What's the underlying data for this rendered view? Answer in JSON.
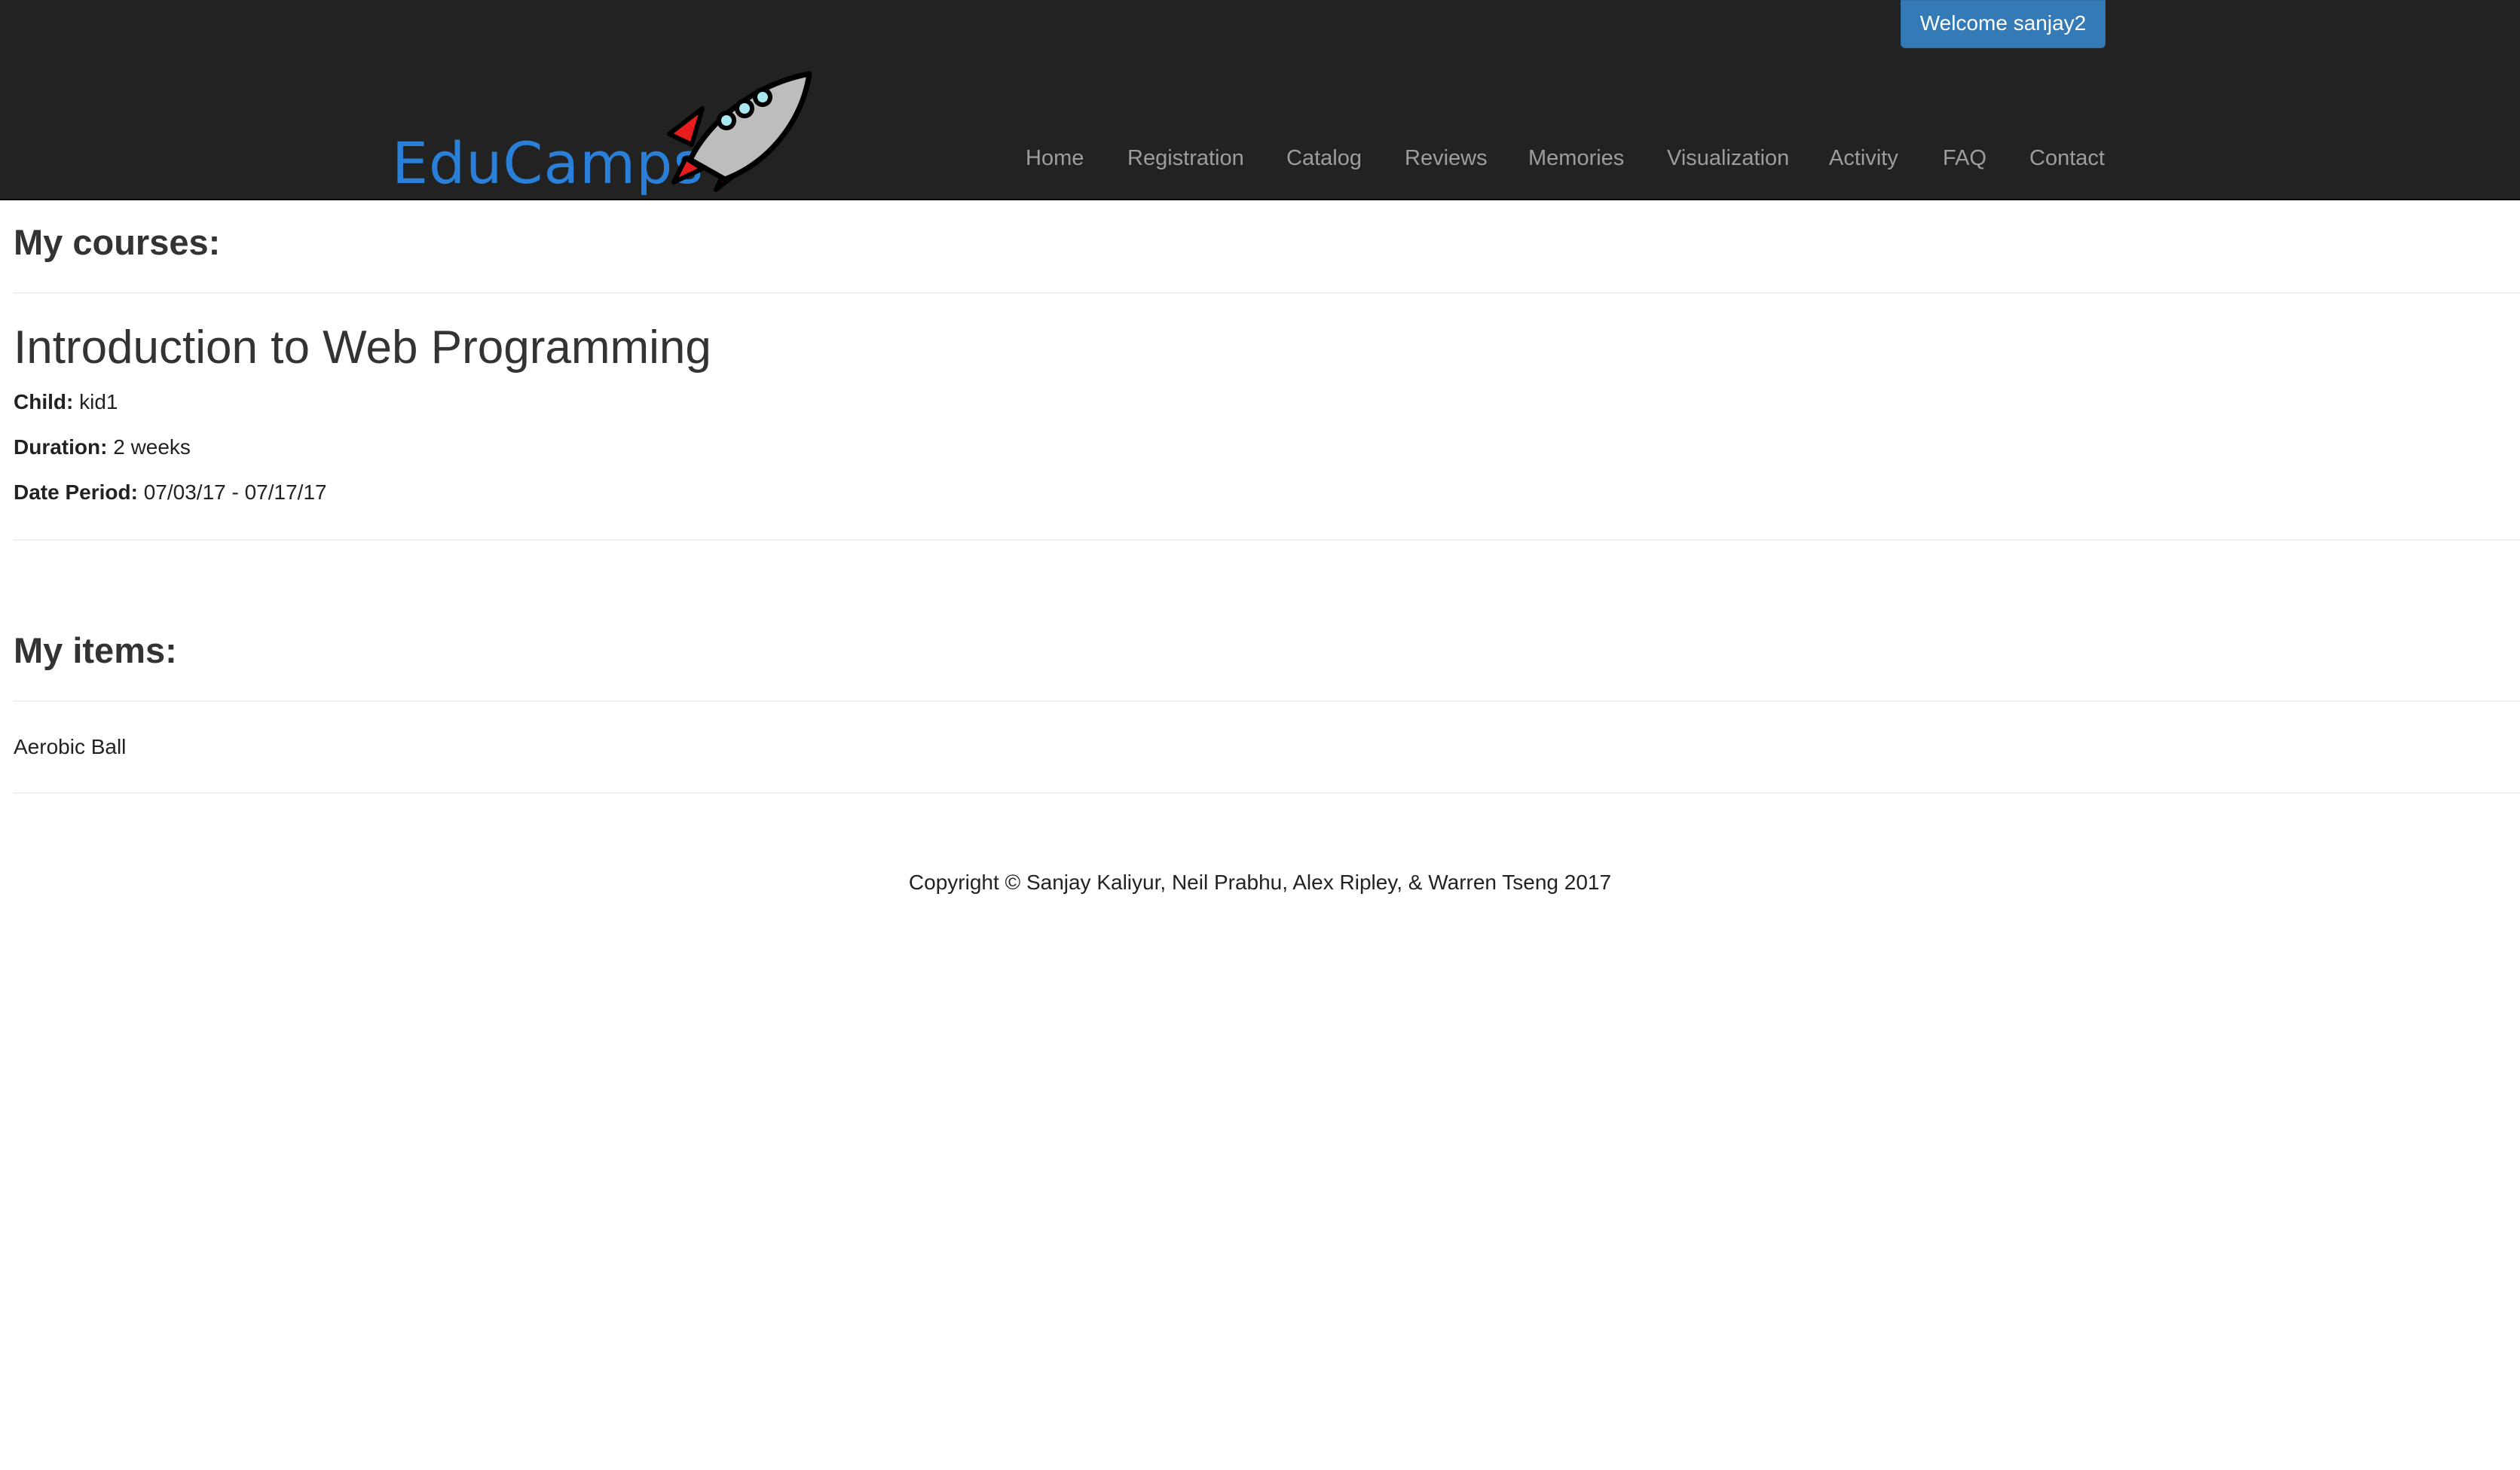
{
  "header": {
    "welcome_label": "Welcome sanjay2",
    "brand_text": "EduCamps",
    "nav": [
      {
        "label": "Home"
      },
      {
        "label": "Registration"
      },
      {
        "label": "Catalog"
      },
      {
        "label": "Reviews"
      },
      {
        "label": "Memories"
      },
      {
        "label": "Visualization"
      },
      {
        "label": "Activity"
      },
      {
        "label": "FAQ"
      },
      {
        "label": "Contact"
      }
    ]
  },
  "courses": {
    "heading": "My courses:",
    "items": [
      {
        "title": "Introduction to Web Programming",
        "child_label": "Child:",
        "child_value": "kid1",
        "duration_label": "Duration:",
        "duration_value": "2 weeks",
        "date_label": "Date Period:",
        "date_value": "07/03/17 - 07/17/17"
      }
    ]
  },
  "items": {
    "heading": "My items:",
    "list": [
      "Aerobic Ball"
    ]
  },
  "footer": {
    "copyright": "Copyright © Sanjay Kaliyur, Neil Prabhu, Alex Ripley, & Warren Tseng 2017"
  },
  "colors": {
    "navbar_bg": "#222222",
    "primary_button": "#337ab7",
    "logo_blue": "#2a7fd9",
    "nav_text": "#9d9d9d"
  }
}
